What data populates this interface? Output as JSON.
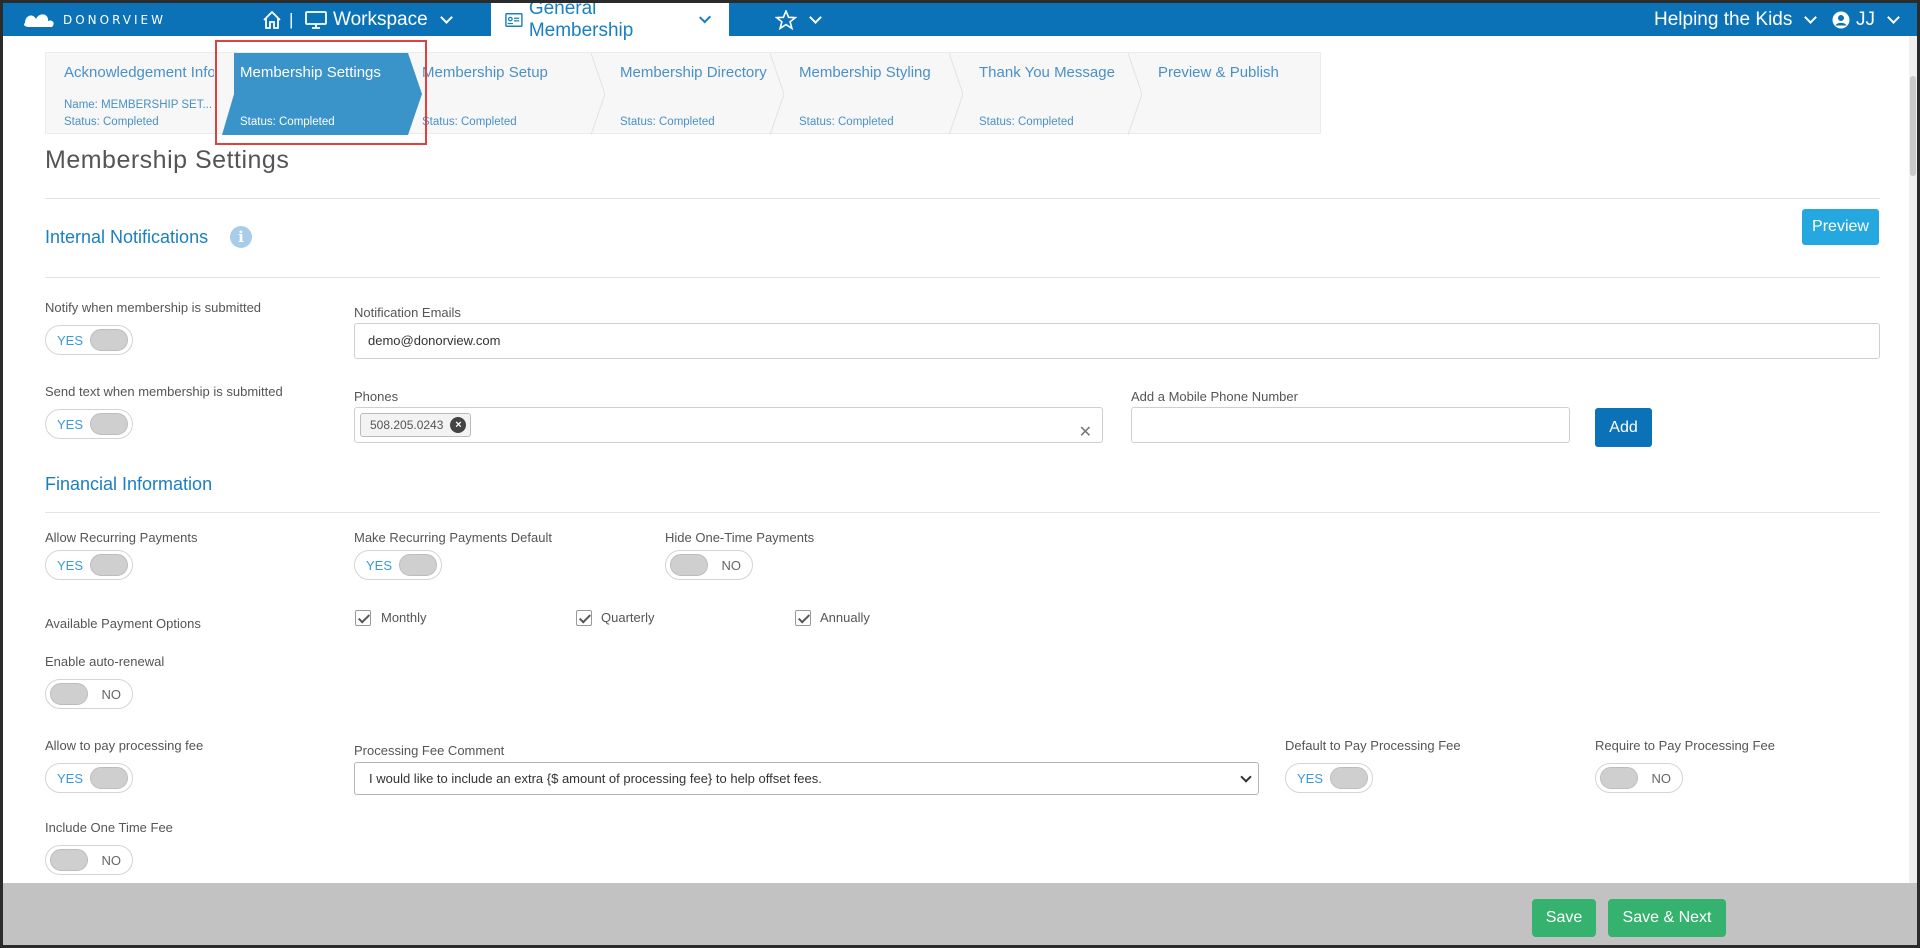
{
  "app": {
    "logo_text": "DONORVIEW"
  },
  "topnav": {
    "workspace_label": "Workspace",
    "form_label": "General Membership",
    "org_label": "Helping the Kids",
    "user_label": "JJ"
  },
  "wizard": {
    "steps": [
      {
        "title": "Acknowledgement Info",
        "name": "Name: MEMBERSHIP SET...",
        "status": "Status: Completed"
      },
      {
        "title": "Membership Settings",
        "status": "Status: Completed"
      },
      {
        "title": "Membership Setup",
        "status": "Status: Completed"
      },
      {
        "title": "Membership Directory",
        "status": "Status: Completed"
      },
      {
        "title": "Membership Styling",
        "status": "Status: Completed"
      },
      {
        "title": "Thank You Message",
        "status": "Status: Completed"
      },
      {
        "title": "Preview & Publish"
      }
    ]
  },
  "page": {
    "title": "Membership Settings",
    "preview_button": "Preview"
  },
  "internal_notifications": {
    "title": "Internal Notifications",
    "notify_label": "Notify when membership is submitted",
    "notify_toggle": "YES",
    "emails_label": "Notification Emails",
    "emails_value": "demo@donorview.com",
    "sms_label": "Send text when membership is submitted",
    "sms_toggle": "YES",
    "phones_label": "Phones",
    "phone_tag": "508.205.0243",
    "add_phone_label": "Add a Mobile Phone Number",
    "add_button": "Add"
  },
  "financial": {
    "title": "Financial Information",
    "allow_recurring_label": "Allow Recurring Payments",
    "allow_recurring_toggle": "YES",
    "recurring_default_label": "Make Recurring Payments Default",
    "recurring_default_toggle": "YES",
    "hide_onetime_label": "Hide One-Time Payments",
    "hide_onetime_toggle": "NO",
    "payment_options_label": "Available Payment Options",
    "payment_options": [
      "Monthly",
      "Quarterly",
      "Annually"
    ],
    "auto_renewal_label": "Enable auto-renewal",
    "auto_renewal_toggle": "NO",
    "processing_fee_label": "Allow to pay processing fee",
    "processing_fee_toggle": "YES",
    "fee_comment_label": "Processing Fee Comment",
    "fee_comment_value": "I would like to include an extra {$ amount of processing fee} to help offset fees.",
    "default_fee_label": "Default to Pay Processing Fee",
    "default_fee_toggle": "YES",
    "require_fee_label": "Require to Pay Processing Fee",
    "require_fee_toggle": "NO",
    "one_time_fee_label": "Include One Time Fee",
    "one_time_fee_toggle": "NO"
  },
  "footer": {
    "save_button": "Save",
    "save_next_button": "Save & Next"
  },
  "colors": {
    "brand_blue": "#0b72b8",
    "accent_blue": "#25a7e0",
    "green": "#35b36e",
    "highlight_red": "#e04040"
  },
  "icons": [
    "logo-icon",
    "home-icon",
    "monitor-icon",
    "id-card-icon",
    "star-icon",
    "user-circle-icon",
    "info-icon",
    "close-icon",
    "check-icon"
  ]
}
